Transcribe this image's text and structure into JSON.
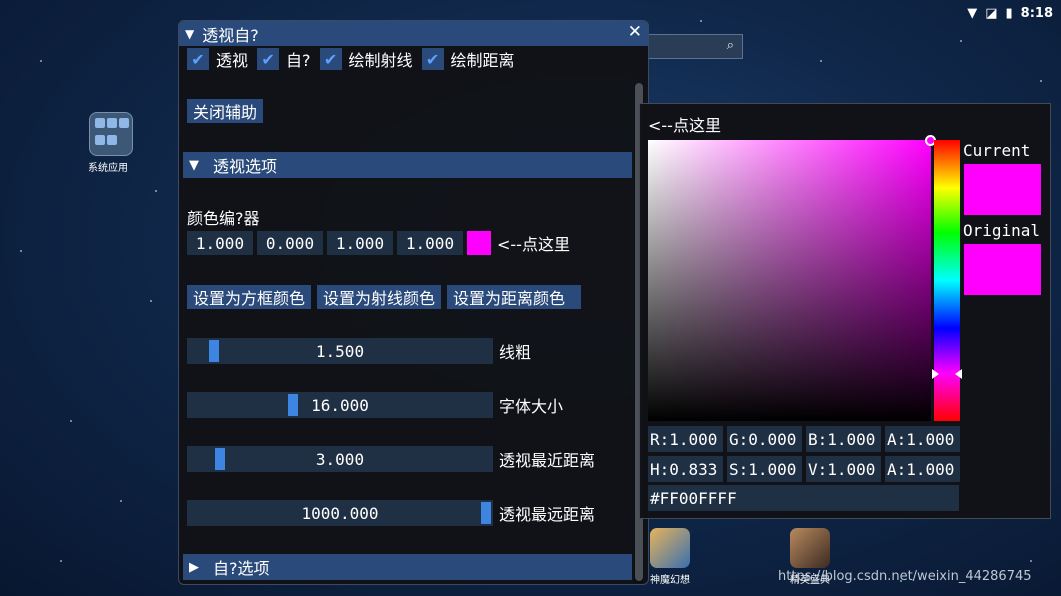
{
  "status_bar": {
    "time": "8:18",
    "wifi_icon": "wifi-icon",
    "signal_icon": "no-signal-icon",
    "battery_icon": "battery-icon"
  },
  "desktop": {
    "system_app_label": "系统应用",
    "dock_apps": [
      {
        "label": "神魔幻想"
      },
      {
        "label": "精英盛典"
      }
    ],
    "watermark": "https://blog.csdn.net/weixin_44286745"
  },
  "window": {
    "title": "透视自?",
    "close_glyph": "✕",
    "collapse_glyph": "▼",
    "checkboxes": [
      {
        "label": "透视",
        "checked": true
      },
      {
        "label": "自?",
        "checked": true
      },
      {
        "label": "绘制射线",
        "checked": true
      },
      {
        "label": "绘制距离",
        "checked": true
      }
    ],
    "close_assist_button": "关闭辅助",
    "section_esp": {
      "label": "透视选项",
      "glyph": "▼"
    },
    "color_editor": {
      "label": "颜色编?器",
      "values": [
        "1.000",
        "0.000",
        "1.000",
        "1.000"
      ],
      "swatch_color": "#FF00FF",
      "hint": "<--点这里"
    },
    "set_buttons": [
      "设置为方框颜色",
      "设置为射线颜色",
      "设置为距离颜色"
    ],
    "sliders": [
      {
        "value_text": "1.500",
        "label": "线粗",
        "fraction": 0.07
      },
      {
        "value_text": "16.000",
        "label": "字体大小",
        "fraction": 0.34
      },
      {
        "value_text": "3.000",
        "label": "透视最近距离",
        "fraction": 0.09
      },
      {
        "value_text": "1000.000",
        "label": "透视最远距离",
        "fraction": 1.0
      }
    ],
    "section_self": {
      "label": "自?选项",
      "glyph": "▶"
    }
  },
  "picker": {
    "title": "<--点这里",
    "current_label": "Current",
    "original_label": "Original",
    "current_color": "#FF00FF",
    "original_color": "#FF00FF",
    "rgba_fields": [
      "R:1.000",
      "G:0.000",
      "B:1.000",
      "A:1.000"
    ],
    "hsva_fields": [
      "H:0.833",
      "S:1.000",
      "V:1.000",
      "A:1.000"
    ],
    "hex": "#FF00FFFF"
  }
}
